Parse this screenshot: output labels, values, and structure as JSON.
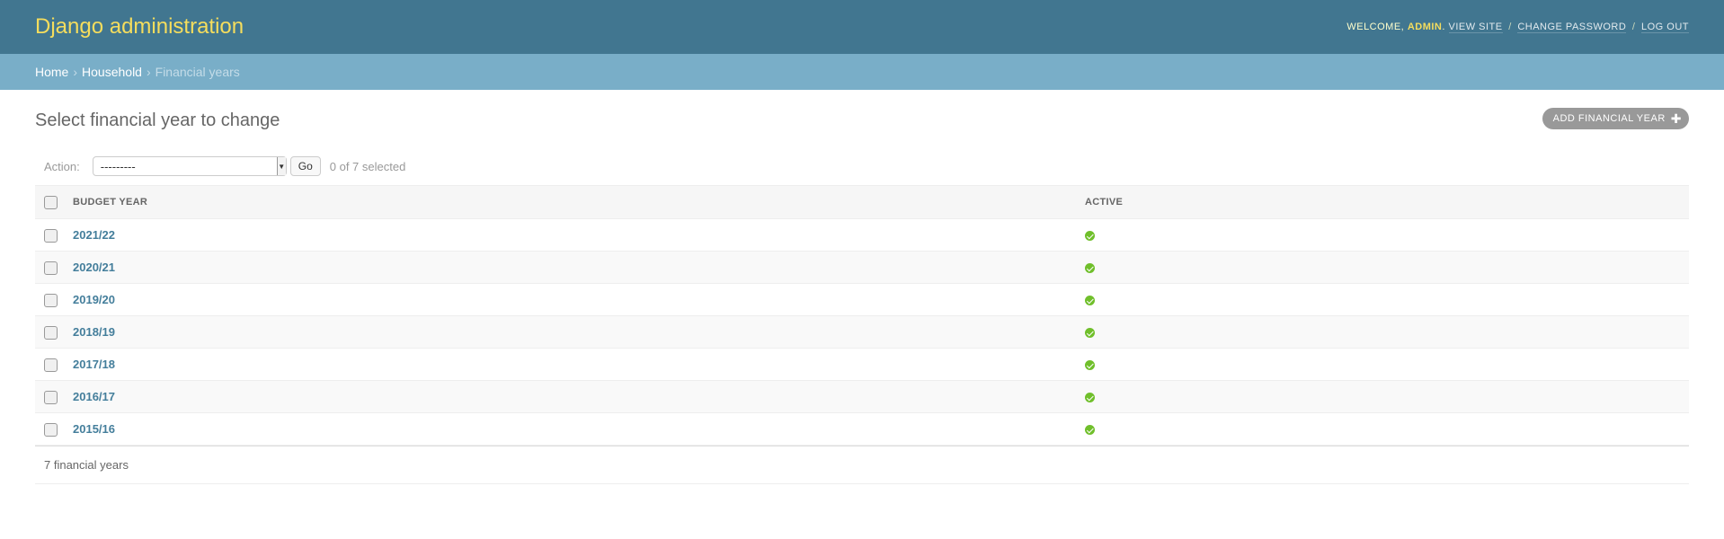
{
  "header": {
    "site_name": "Django administration",
    "welcome": "Welcome,",
    "username": "admin",
    "view_site": "View site",
    "change_password": "Change password",
    "log_out": "Log out",
    "separator": "/"
  },
  "breadcrumbs": {
    "home": "Home",
    "app": "Household",
    "current": "Financial years",
    "separator": "›"
  },
  "page": {
    "title": "Select financial year to change",
    "add_label": "Add financial year",
    "add_icon": "plus-icon"
  },
  "actions": {
    "label": "Action:",
    "selected_value": "---------",
    "go_label": "Go",
    "counter": "0 of 7 selected"
  },
  "table": {
    "columns": [
      "Budget year",
      "Active"
    ],
    "rows": [
      {
        "year": "2021/22",
        "active": true
      },
      {
        "year": "2020/21",
        "active": true
      },
      {
        "year": "2019/20",
        "active": true
      },
      {
        "year": "2018/19",
        "active": true
      },
      {
        "year": "2017/18",
        "active": true
      },
      {
        "year": "2016/17",
        "active": true
      },
      {
        "year": "2015/16",
        "active": true
      }
    ]
  },
  "paginator": {
    "text": "7 financial years"
  },
  "colors": {
    "header_bg": "#417690",
    "breadcrumb_bg": "#79aec8",
    "site_name": "#f5dd5d",
    "link": "#447e9b",
    "active_icon": "#70bf2b"
  }
}
